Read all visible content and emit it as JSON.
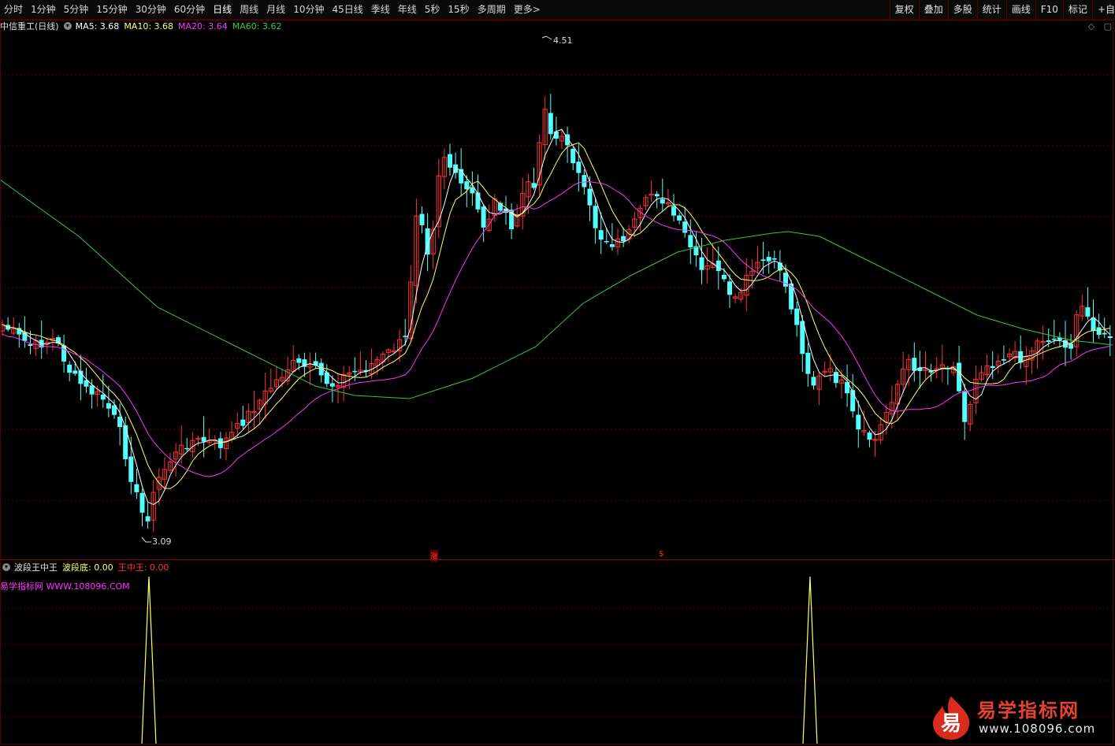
{
  "toolbar": {
    "periods": [
      "分时",
      "1分钟",
      "5分钟",
      "15分钟",
      "30分钟",
      "60分钟",
      "日线",
      "周线",
      "月线",
      "10分钟",
      "45日线",
      "季线",
      "年线",
      "5秒",
      "15秒",
      "多周期",
      "更多>"
    ],
    "active_period": "日线",
    "right_buttons": [
      "复权",
      "叠加",
      "多股",
      "统计",
      "画线",
      "F10",
      "标记",
      "+自"
    ]
  },
  "main_chart": {
    "title": "中信重工(日线)",
    "ma5": "MA5: 3.68",
    "ma10": "MA10: 3.68",
    "ma20": "MA20: 3.64",
    "ma60": "MA60: 3.62",
    "high_label": "4.51",
    "low_label": "3.09",
    "marker_zhang": "涨",
    "marker_dollar": "$"
  },
  "indicator": {
    "name": "波段王中王",
    "bottom_label": "波段底: 0.00",
    "king_label": "王中王: 0.00",
    "site": "易学指标网 WWW.108096.COM"
  },
  "logo": {
    "glyph": "易",
    "name": "易学指标网",
    "url": "www.108096.com"
  },
  "colors": {
    "up": "#ff3333",
    "down": "#54ffff",
    "ma5": "#ffffff",
    "ma10": "#ffff66",
    "ma20": "#ff33ff",
    "ma60": "#33cc33"
  }
}
